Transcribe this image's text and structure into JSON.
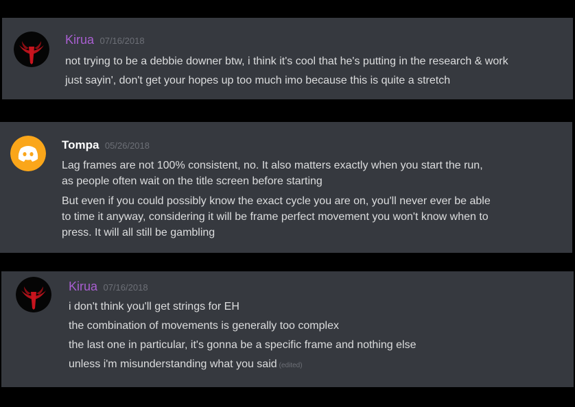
{
  "colors": {
    "background": "#000000",
    "card": "#36393f",
    "text": "#dcddde",
    "timestamp": "#6d7077",
    "kirua_name": "#a95fd1",
    "tompa_name": "#ffffff",
    "discord_avatar_bg": "#faa61a"
  },
  "messages": [
    {
      "author": "Kirua",
      "timestamp": "07/16/2018",
      "avatar_icon": "quake3-logo-icon",
      "lines": [
        "not trying to be a debbie downer btw, i think it's cool that he's putting in the research & work",
        "just sayin', don't get your hopes up too much imo because this is quite a stretch"
      ]
    },
    {
      "author": "Tompa",
      "timestamp": "05/26/2018",
      "avatar_icon": "discord-default-avatar-icon",
      "lines": [
        "Lag frames are not 100% consistent, no. It also matters exactly when you start the run,",
        "as people often wait on the title screen before starting",
        "But even if you could possibly know the exact cycle you are on, you'll never ever be able",
        "to time it anyway, considering it will be frame perfect movement you won't know when to",
        "press. It will all still be gambling"
      ]
    },
    {
      "author": "Kirua",
      "timestamp": "07/16/2018",
      "avatar_icon": "quake3-logo-icon",
      "lines": [
        "i don't think you'll get strings for EH",
        "the combination of movements is generally too complex",
        "the last one in particular, it's gonna be a specific frame and nothing else",
        "unless i'm misunderstanding what you said"
      ],
      "edited_label": "(edited)"
    }
  ]
}
